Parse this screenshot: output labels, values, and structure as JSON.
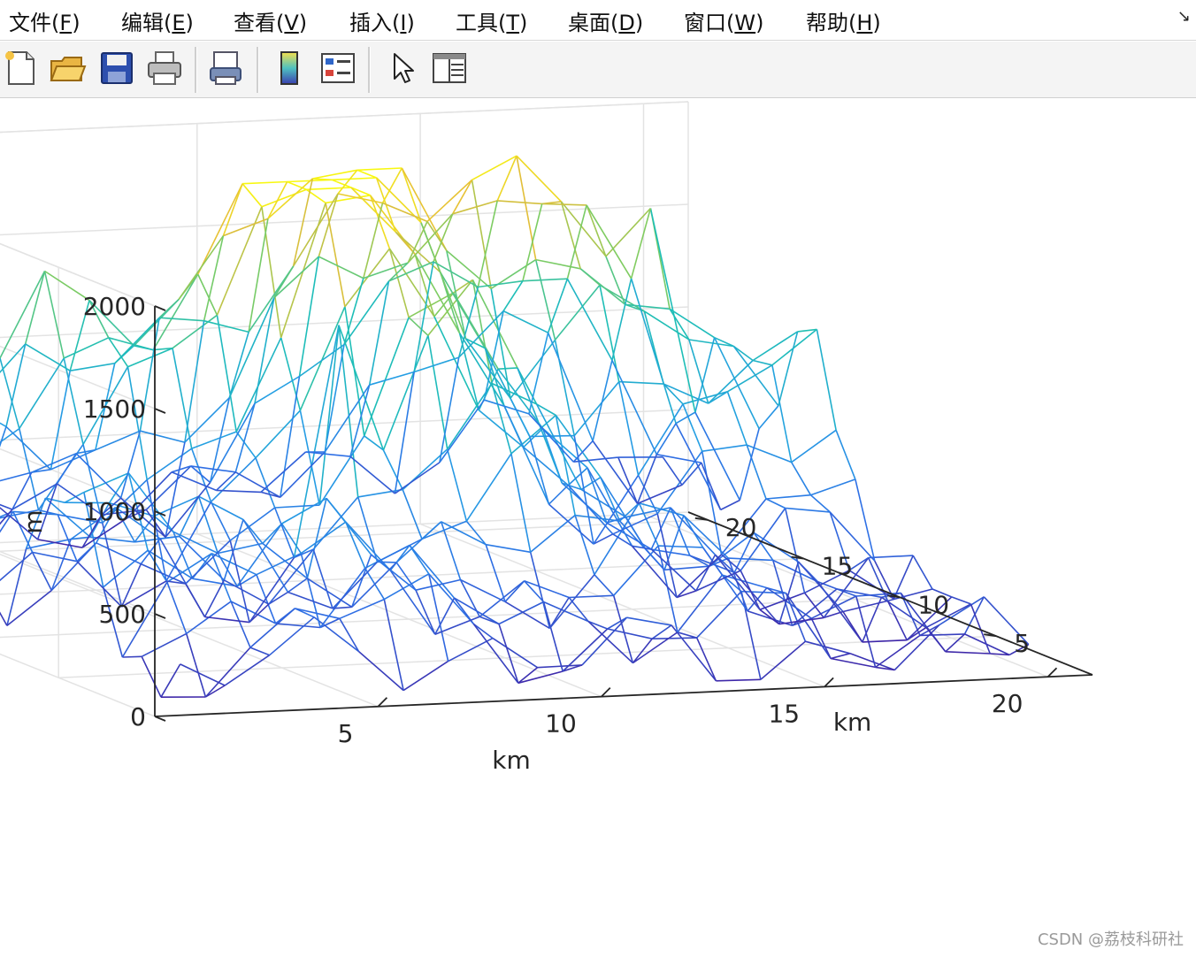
{
  "menu": {
    "items": [
      {
        "label": "文件(",
        "acc": "F",
        "end": ")"
      },
      {
        "label": "编辑(",
        "acc": "E",
        "end": ")"
      },
      {
        "label": "查看(",
        "acc": "V",
        "end": ")"
      },
      {
        "label": "插入(",
        "acc": "I",
        "end": ")"
      },
      {
        "label": "工具(",
        "acc": "T",
        "end": ")"
      },
      {
        "label": "桌面(",
        "acc": "D",
        "end": ")"
      },
      {
        "label": "窗口(",
        "acc": "W",
        "end": ")"
      },
      {
        "label": "帮助(",
        "acc": "H",
        "end": ")"
      }
    ],
    "dock_glyph": "↘"
  },
  "toolbar": {
    "icons": [
      "new-file-icon",
      "open-folder-icon",
      "save-disk-icon",
      "print-icon",
      "print-preview-icon",
      "colorbar-icon",
      "legend-icon",
      "pointer-arrow-icon",
      "property-inspector-icon"
    ]
  },
  "chart_data": {
    "type": "mesh",
    "colormap": "parula",
    "z_ticks": [
      "0",
      "500",
      "1000",
      "1500",
      "2000"
    ],
    "y_ticks": [
      "5",
      "10",
      "15",
      "20"
    ],
    "x_ticks": [
      "5",
      "10",
      "15",
      "20"
    ],
    "zlabel": "m",
    "ylabel": "km",
    "xlabel": "km",
    "xlim": [
      0,
      21
    ],
    "ylim": [
      0,
      21
    ],
    "zlim": [
      0,
      2000
    ],
    "grid": true
  },
  "watermark": "CSDN @荔枝科研社"
}
